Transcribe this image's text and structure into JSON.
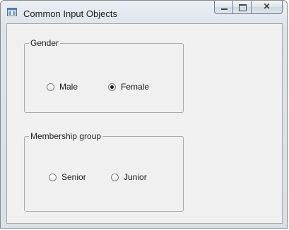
{
  "window": {
    "title": "Common Input Objects",
    "buttons": {
      "minimize": "minimize",
      "maximize": "maximize",
      "close": "✕"
    }
  },
  "gender": {
    "legend": "Gender",
    "options": [
      {
        "label": "Male",
        "checked": false
      },
      {
        "label": "Female",
        "checked": true
      }
    ]
  },
  "membership": {
    "legend": "Membership group",
    "options": [
      {
        "label": "Senior",
        "checked": false
      },
      {
        "label": "Junior",
        "checked": false
      }
    ]
  }
}
